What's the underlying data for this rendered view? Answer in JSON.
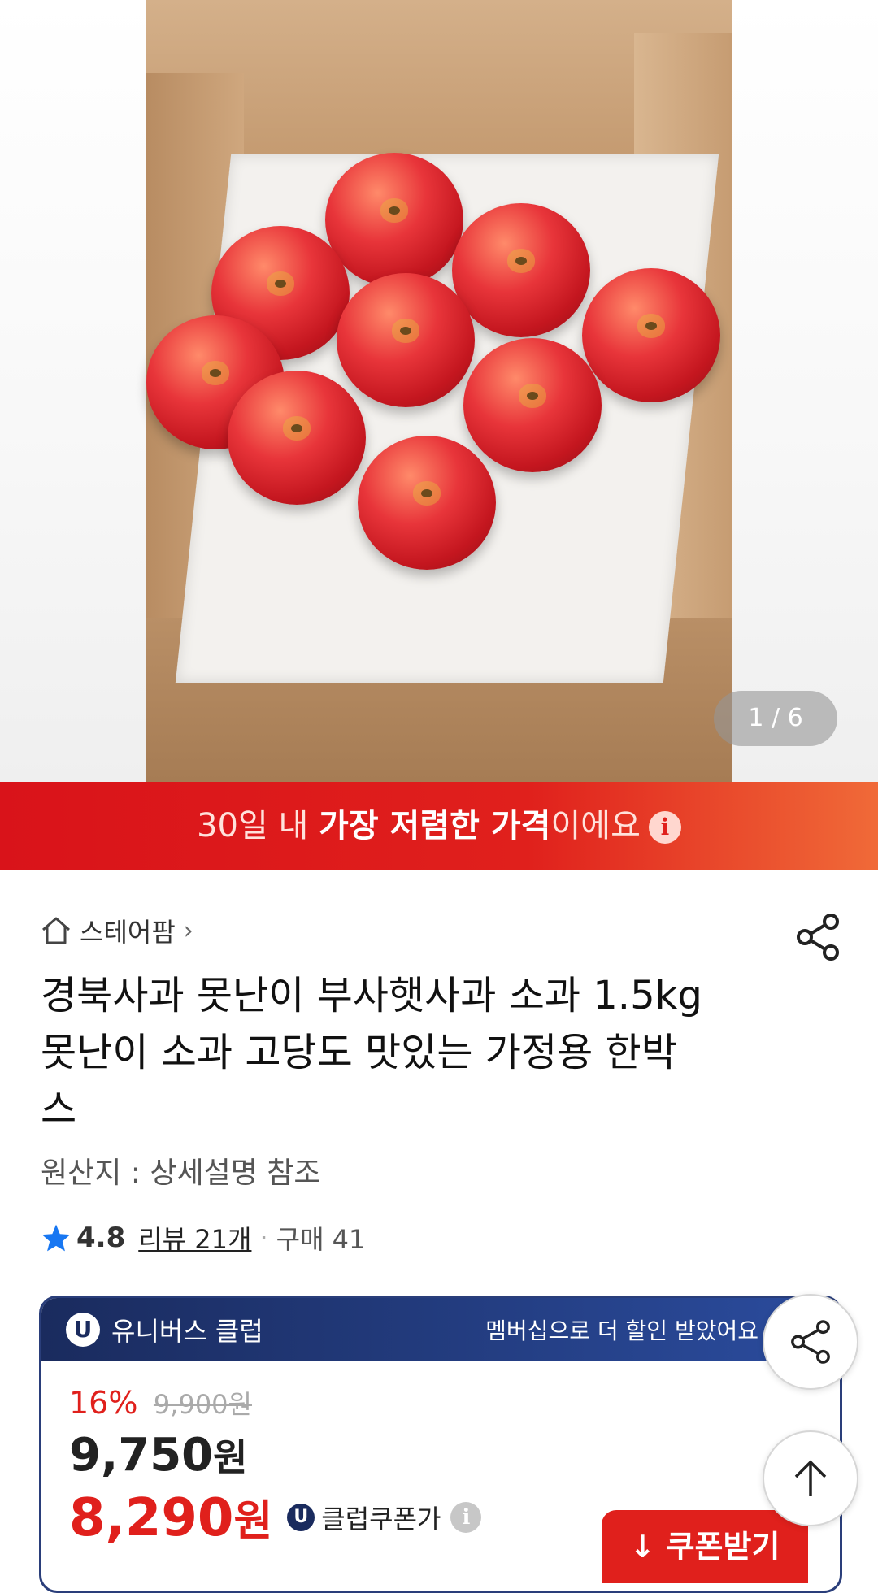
{
  "hero": {
    "counter_current": "1",
    "counter_sep": " / ",
    "counter_total": "6"
  },
  "banner": {
    "prefix": "30일 내 ",
    "bold": "가장 저렴한 가격",
    "suffix": "이에요",
    "info_glyph": "i",
    "colors": {
      "start": "#d9131a",
      "end": "#f06a38"
    }
  },
  "store": {
    "icon": "home-icon",
    "name": "스테어팜",
    "chevron": "›"
  },
  "product": {
    "title": "경북사과 못난이 부사햇사과 소과 1.5kg 못난이 소과 고당도 맛있는 가정용 한박스",
    "origin": "원산지 : 상세설명 참조",
    "rating": "4.8",
    "review_link": "리뷰 21개",
    "separator": "·",
    "purchases": "구매 41"
  },
  "membership": {
    "badge": "U",
    "club_name": "유니버스 클럽",
    "tagline": "멤버십으로 더 할인 받았어요",
    "discount_pct": "16%",
    "original_price": "9,900원",
    "sale_price_num": "9,750",
    "sale_price_unit": "원",
    "club_price_num": "8,290",
    "club_price_unit": "원",
    "club_badge": "U",
    "club_coupon_label": "클럽쿠폰가",
    "info_glyph": "i",
    "accent_color": "#1a2b5e"
  },
  "coupon_button": {
    "label": "↓ 쿠폰받기",
    "color": "#e0201c"
  },
  "fabs": {
    "share_icon": "share-icon",
    "top_icon": "arrow-up-icon"
  }
}
